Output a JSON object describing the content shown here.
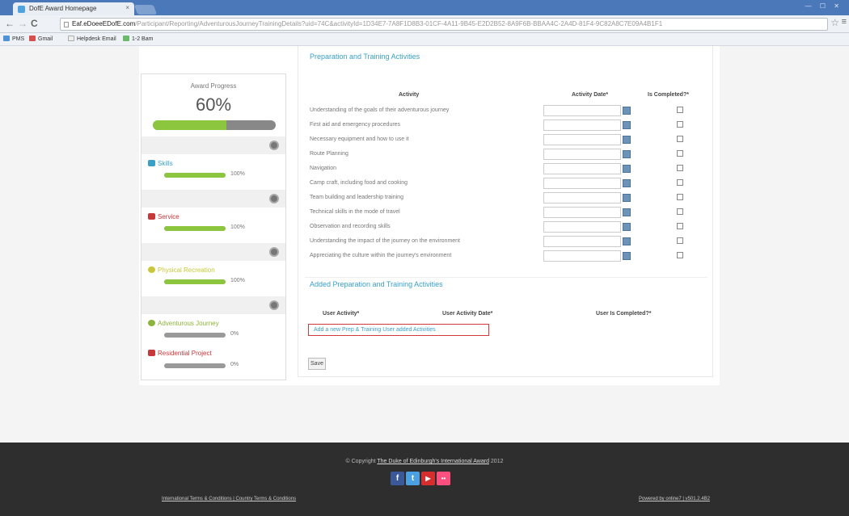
{
  "browser": {
    "tab_title": "DofE Award Homepage",
    "tab_close": "×",
    "window_controls": "— ☐ ✕",
    "url_host": "Eaf.eDoeeEDofE.com",
    "url_path": "/Participant/Reporting/AdventurousJourneyTrainingDetails?uid=74C&activityId=1D34E7-7A8F1D8B3-01CF-4A11-9B45-E2D2B52-8A9F6B-BBAA4C-2A4D-81F4-9C82A8C7E09A4B1F1",
    "back": "←",
    "forward": "→",
    "reload": "C",
    "star": "☆",
    "menu": "≡",
    "bookmarks": [
      {
        "label": "PMS",
        "color": "#4f93d6"
      },
      {
        "label": "Gmail",
        "color": "#d64f4f"
      },
      {
        "label": "Helpdesk Email",
        "color": "#eeeeee"
      },
      {
        "label": "1-2 Bam",
        "color": "#6bb96b"
      }
    ]
  },
  "sidebar": {
    "progress_title": "Award Progress",
    "progress_pct": "60%",
    "progress_value": 0.6,
    "sections": [
      {
        "name": "Skills",
        "pct": "100%",
        "value": 1.0,
        "color": "#3aa0c8"
      },
      {
        "name": "Service",
        "pct": "100%",
        "value": 1.0,
        "color": "#c8373a"
      },
      {
        "name": "Physical Recreation",
        "pct": "100%",
        "value": 1.0,
        "color": "#c9c83a"
      },
      {
        "name": "Adventurous Journey",
        "pct": "0%",
        "value": 0.0,
        "color": "#8cb43a"
      },
      {
        "name": "Residential Project",
        "pct": "0%",
        "value": 0.0,
        "color": "#c8373a"
      }
    ]
  },
  "main": {
    "section_heading": "Preparation and Training Activities",
    "col_activity": "Activity",
    "col_date": "Activity Date*",
    "col_completed": "Is Completed?*",
    "activities": [
      "Understanding of the goals of their adventurous journey",
      "First aid and emergency procedures",
      "Necessary equipment and how to use it",
      "Route Planning",
      "Navigation",
      "Camp craft, including food and cooking",
      "Team building and leadership training",
      "Technical skills in the mode of travel",
      "Observation and recording skills",
      "Understanding the impact of the journey on the environment",
      "Appreciating the culture within the journey's environment"
    ],
    "added_heading": "Added Preparation and Training Activities",
    "user_activity": "User Activity*",
    "user_activity_date": "User Activity Date*",
    "user_is_completed": "User Is Completed?*",
    "add_link": "Add a new Prep & Training User added Activities",
    "save_label": "Save"
  },
  "footer": {
    "copyright_prefix": "© Copyright ",
    "copyright_link": "The Duke of Edinburgh's International Award",
    "copyright_year": " 2012",
    "links": "International Terms & Conditions   |   Country Terms & Conditions",
    "powered": "Powered by online7 | v501.2.4B2",
    "social": [
      {
        "name": "facebook",
        "glyph": "f",
        "color": "#3b5998"
      },
      {
        "name": "twitter",
        "glyph": "t",
        "color": "#4aa0e0"
      },
      {
        "name": "youtube",
        "glyph": "▶",
        "color": "#d62e2e"
      },
      {
        "name": "flickr",
        "glyph": "••",
        "color": "#ff4f7e"
      }
    ]
  }
}
